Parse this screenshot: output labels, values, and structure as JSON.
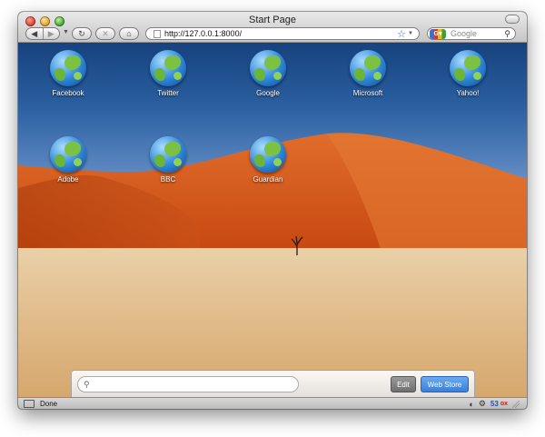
{
  "window": {
    "title": "Start Page"
  },
  "toolbar": {
    "back_icon": "back-arrow-icon",
    "forward_icon": "forward-arrow-icon",
    "reload_icon": "reload-icon",
    "stop_icon": "stop-icon",
    "home_icon": "home-icon",
    "url": "http://127.0.0.1:8000/",
    "search_placeholder": "Google"
  },
  "speed_dial": {
    "tiles": [
      {
        "label": "Facebook"
      },
      {
        "label": "Twitter"
      },
      {
        "label": "Google"
      },
      {
        "label": "Microsoft"
      },
      {
        "label": "Yahoo!"
      },
      {
        "label": "Adobe"
      },
      {
        "label": "BBC"
      },
      {
        "label": "Guardian"
      }
    ]
  },
  "bottom_bar": {
    "search_placeholder": "",
    "edit_label": "Edit",
    "store_label": "Web Store"
  },
  "statusbar": {
    "status_text": "Done",
    "badge_count": "53",
    "badge_red": "ox"
  },
  "colors": {
    "accent_blue": "#3a7fd8",
    "sky_top": "#17427e",
    "dune": "#d8561d",
    "sand": "#e4c395"
  }
}
